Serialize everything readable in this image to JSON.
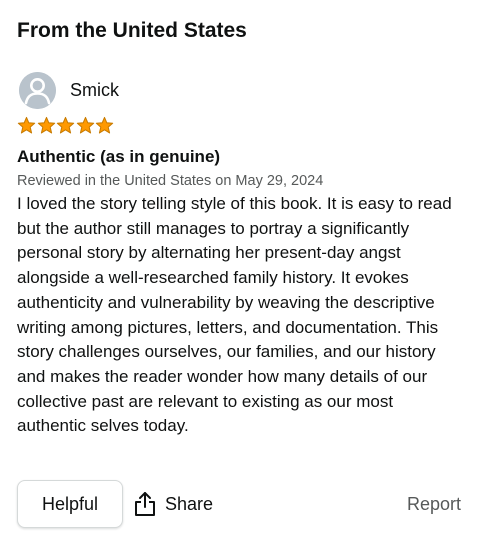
{
  "section": {
    "heading": "From the United States"
  },
  "review": {
    "reviewer_name": "Smick",
    "rating": 5,
    "rating_max": 5,
    "star_color": "#ff9900",
    "avatar_icon": "default-user-avatar-icon",
    "title": "Authentic (as in genuine)",
    "date_line": "Reviewed in the United States on May 29, 2024",
    "body": "I loved the story telling style of this book. It is easy to read but the author still manages to portray a significantly personal story by alternating her present-day angst alongside a well-researched family history. It evokes authenticity and vulnerability by weaving the descriptive writing among pictures, letters, and documentation. This story challenges ourselves, our families, and our history and makes the reader wonder how many details of our collective past are relevant to existing as our most authentic selves today."
  },
  "actions": {
    "helpful_label": "Helpful",
    "share_label": "Share",
    "share_icon": "share-icon",
    "report_label": "Report"
  }
}
